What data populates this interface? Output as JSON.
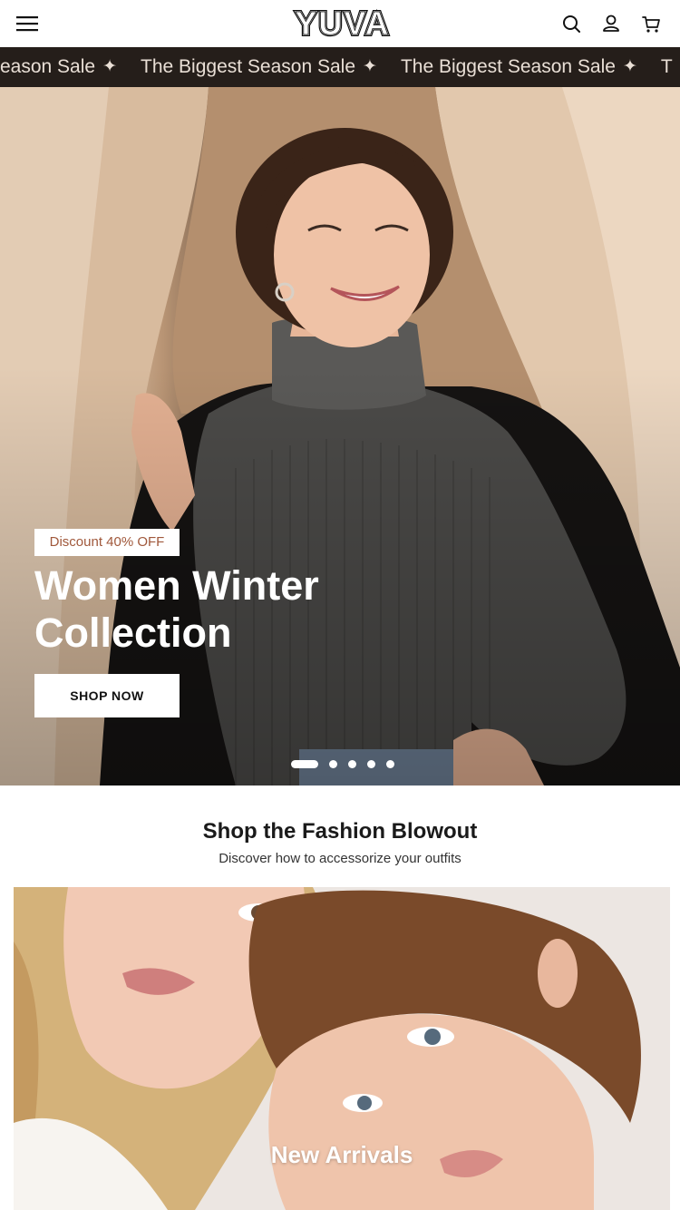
{
  "header": {
    "menu_icon": "hamburger-menu-icon",
    "logo_text": "YUVA",
    "search_icon": "search-icon",
    "account_icon": "user-icon",
    "cart_icon": "cart-icon"
  },
  "announcement": {
    "items": [
      "eason Sale",
      "The Biggest Season Sale",
      "The Biggest Season Sale",
      "T"
    ],
    "separator": "✦",
    "background": "#251e1a",
    "text_color": "#e9dfd6"
  },
  "hero": {
    "badge": "Discount 40% OFF",
    "title_line1": "Women Winter",
    "title_line2": "Collection",
    "button_label": "SHOP NOW",
    "slides_total": 5,
    "active_slide": 1,
    "badge_color": "#a0583b"
  },
  "section": {
    "title": "Shop the Fashion Blowout",
    "subtitle": "Discover how to accessorize your outfits"
  },
  "category_card": {
    "label": "New Arrivals"
  }
}
